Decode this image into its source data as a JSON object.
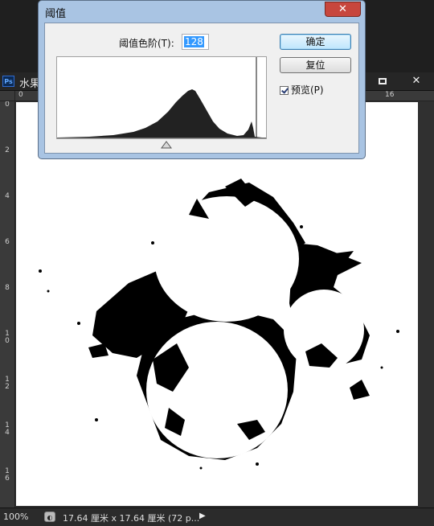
{
  "document": {
    "title": "水果",
    "ruler_h": [
      "0",
      "16"
    ],
    "ruler_v": [
      "0",
      "2",
      "4",
      "6",
      "8",
      "10",
      "12",
      "14",
      "16"
    ],
    "zoom": "100%",
    "size_info": "17.64 厘米 x 17.64 厘米 (72 p..."
  },
  "dialog": {
    "title": "阈值",
    "close": "✕",
    "level_label": "阈值色阶(T):",
    "level_value": "128",
    "ok_label": "确定",
    "reset_label": "复位",
    "preview_label": "预览(P)",
    "preview_checked": true
  },
  "colors": {
    "dialog_frame": "#a9c4e3",
    "close_button": "#c7463d",
    "input_highlight": "#3399ff"
  }
}
